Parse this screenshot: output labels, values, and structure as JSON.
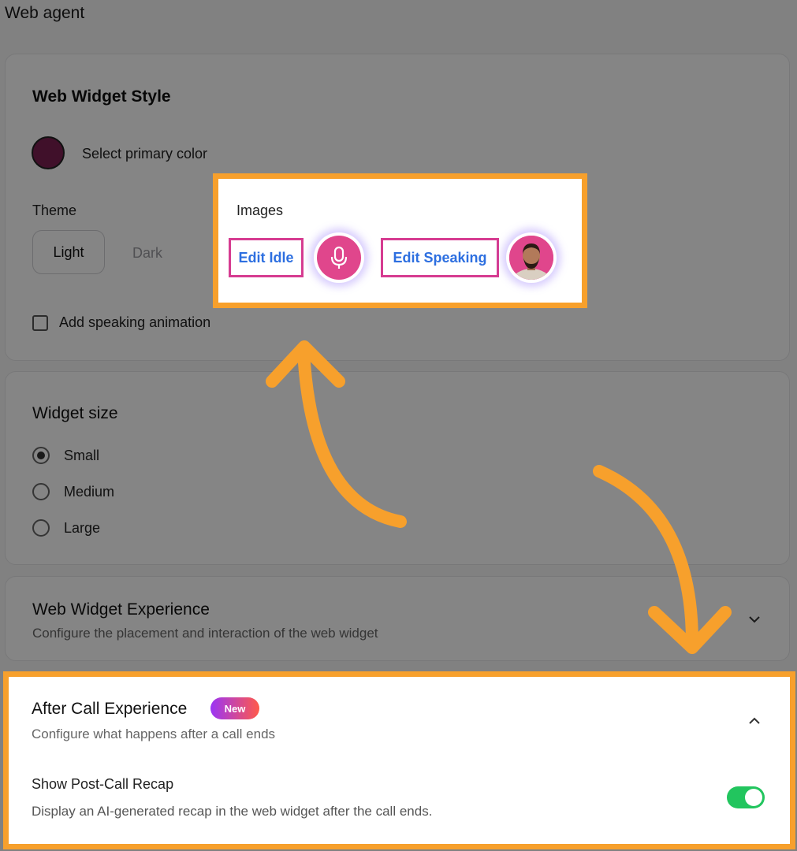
{
  "page": {
    "title": "Web agent"
  },
  "style_card": {
    "title": "Web Widget Style",
    "primary_color_label": "Select primary color",
    "primary_color": "#7b1f52",
    "theme_label": "Theme",
    "theme_options": [
      "Light",
      "Dark"
    ],
    "theme_selected": "Light",
    "speaking_animation_label": "Add speaking animation",
    "speaking_animation_checked": false
  },
  "images_callout": {
    "title": "Images",
    "edit_idle_label": "Edit Idle",
    "idle_icon": "microphone-icon",
    "edit_speaking_label": "Edit Speaking",
    "speaking_icon": "avatar-photo"
  },
  "size_card": {
    "title": "Widget size",
    "options": [
      "Small",
      "Medium",
      "Large"
    ],
    "selected": "Small"
  },
  "experience_card": {
    "title": "Web Widget Experience",
    "subtitle": "Configure the placement and interaction of the web widget",
    "expanded": false
  },
  "after_call": {
    "title": "After Call Experience",
    "badge": "New",
    "subtitle": "Configure what happens after a call ends",
    "recap_title": "Show Post-Call Recap",
    "recap_desc": "Display an AI-generated recap in the web widget after the call ends.",
    "recap_enabled": true,
    "expanded": true
  },
  "colors": {
    "highlight": "#f7a02c",
    "edit_border": "#d63c91",
    "link": "#2d6fe0",
    "toggle_on": "#22c55e",
    "badge_gradient": [
      "#9b35f5",
      "#ff5a4a"
    ]
  }
}
